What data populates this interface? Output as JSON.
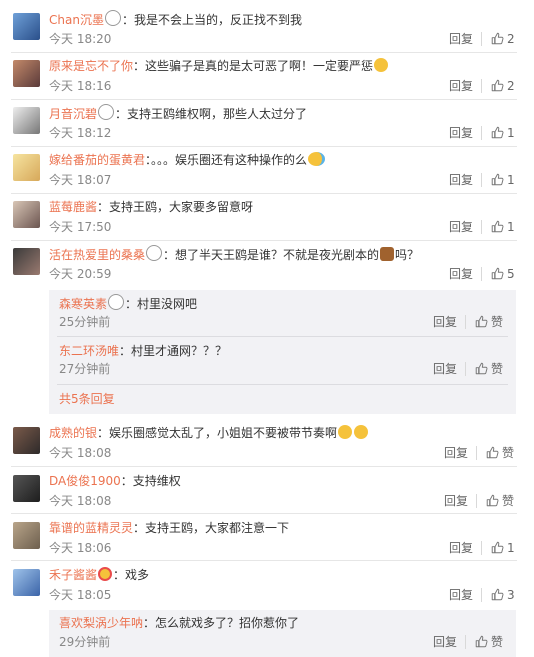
{
  "colors": {
    "username": "#eb7350",
    "time": "#888888",
    "action": "#666666",
    "subbox": "#f2f2f5"
  },
  "comments": [
    {
      "user": "Chan沉墨",
      "emoji": "panda-icon",
      "text": "：我是不会上当的，反正找不到我",
      "time": "今天 18:20",
      "reply": "回复",
      "likes": "2"
    },
    {
      "user": "原来是忘不了你",
      "emoji": "",
      "text": "：这些骗子是真的是太可恶了啊！一定要严惩",
      "emoji_after": "face-icon",
      "time": "今天 18:16",
      "reply": "回复",
      "likes": "2"
    },
    {
      "user": "月音沉碧",
      "emoji": "panda-icon",
      "text": "：支持王鸥维权啊，那些人太过分了",
      "time": "今天 18:12",
      "reply": "回复",
      "likes": "1"
    },
    {
      "user": "嫁给番茄的蛋黄君",
      "emoji": "",
      "text": "：。。。娱乐圈还有这种操作的么",
      "emoji_after": "sweat-face-icon",
      "time": "今天 18:07",
      "reply": "回复",
      "likes": "1"
    },
    {
      "user": "蓝莓鹿酱",
      "emoji": "",
      "text": "：支持王鸥，大家要多留意呀",
      "time": "今天 17:50",
      "reply": "回复",
      "likes": "1"
    },
    {
      "user": "活在热爱里的桑桑",
      "emoji": "panda-icon",
      "text": "：想了半天王鸥是谁？不就是夜光剧本的",
      "emoji_after": "horse-icon",
      "text2": "吗？",
      "time": "今天 20:59",
      "reply": "回复",
      "likes": "5"
    }
  ],
  "subreplies": [
    {
      "user": "森寒英素",
      "emoji": "panda-icon",
      "text": "：村里没网吧",
      "time": "25分钟前",
      "reply": "回复",
      "likes": "赞"
    },
    {
      "user": "东二环汤唯",
      "emoji": "",
      "text": "：村里才通网？？？",
      "time": "27分钟前",
      "reply": "回复",
      "likes": "赞"
    }
  ],
  "more_replies": "共5条回复",
  "comments2": [
    {
      "user": "成熟的银",
      "emoji": "",
      "text": "：娱乐圈感觉太乱了，小姐姐不要被带节奏啊",
      "emoji_after": "laugh-cry-icon",
      "time": "今天 18:08",
      "reply": "回复",
      "likes": "赞"
    },
    {
      "user": "DA俊俊1900",
      "emoji": "",
      "text": "：支持维权",
      "time": "今天 18:08",
      "reply": "回复",
      "likes": "赞"
    },
    {
      "user": "靠谱的蓝精灵灵",
      "emoji": "",
      "text": "：支持王鸥，大家都注意一下",
      "time": "今天 18:06",
      "reply": "回复",
      "likes": "1"
    },
    {
      "user": "禾子酱酱",
      "emoji": "heart-eyes-icon",
      "text": "：戏多",
      "time": "今天 18:05",
      "reply": "回复",
      "likes": "3"
    }
  ],
  "subreplies2": [
    {
      "user": "喜欢梨涡少年呐",
      "emoji": "",
      "text": "：怎么就戏多了？招你惹你了",
      "time": "29分钟前",
      "reply": "回复",
      "likes": "赞"
    }
  ]
}
